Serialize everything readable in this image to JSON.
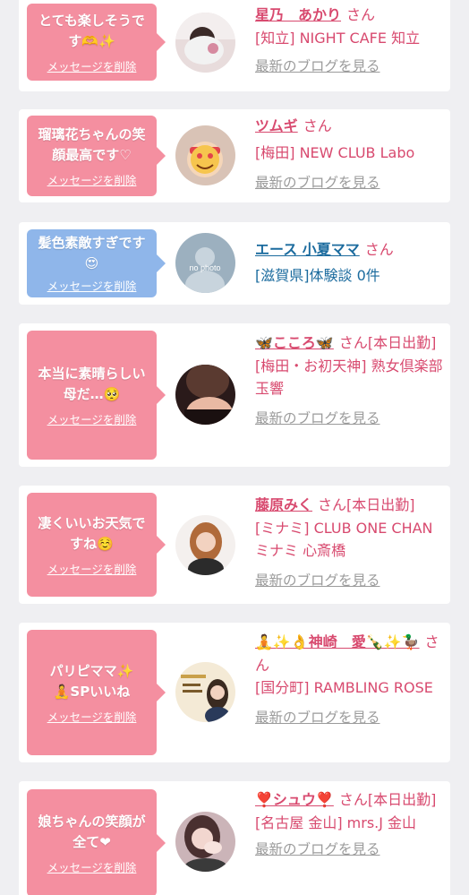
{
  "labels": {
    "delete": "メッセージを削除",
    "blog": "最新のブログを見る",
    "san": "さん"
  },
  "colors": {
    "pink": "#f48fa0",
    "blue": "#8fb6ea",
    "name_pink": "#d84a6f",
    "name_blue": "#1b6b9e",
    "link_gray": "#9b9b9b"
  },
  "entries": [
    {
      "msg1": "とても楽しそうで",
      "msg2": "す🫶✨",
      "name": "星乃　あかり",
      "shop": "[知立] NIGHT CAFE 知立",
      "avatar": "girl-photo"
    },
    {
      "msg1": "瑠璃花ちゃんの笑",
      "msg2": "顔最高です♡",
      "name": "ツムギ",
      "shop": "[梅田] NEW CLUB Labo",
      "avatar": "emoji-photo"
    },
    {
      "msg1": "髪色素敵すぎです",
      "msg2": "😍",
      "name": "エース 小夏ママ",
      "shop": "[滋賀県]体験談 0件",
      "avatar": "no-photo"
    },
    {
      "msg1": "本当に素晴らしい",
      "msg2": "母だ…🥺",
      "name": "🦋こころ🦋",
      "status": "[本日出勤]",
      "shop": "[梅田・お初天神] 熟女倶楽部 玉響",
      "avatar": "lady-photo"
    },
    {
      "msg1": "凄くいいお天気で",
      "msg2": "すね☺️",
      "name": "藤原みく",
      "status": "[本日出勤]",
      "shop": "[ミナミ] CLUB ONE CHAN ミナミ 心斎橋",
      "avatar": "girl-photo-2"
    },
    {
      "msg1": "パリピママ✨",
      "msg2": "🧘SPいいね",
      "name": "🧘✨👌神崎　愛🍾✨🦆",
      "shop": "[国分町] RAMBLING ROSE",
      "avatar": "poster-photo"
    },
    {
      "msg1": "娘ちゃんの笑顔が",
      "msg2": "全て❤",
      "name": "❣️シュウ❣️",
      "status": "[本日出勤]",
      "shop": "[名古屋 金山] mrs.J 金山",
      "avatar": "hand-photo"
    }
  ]
}
